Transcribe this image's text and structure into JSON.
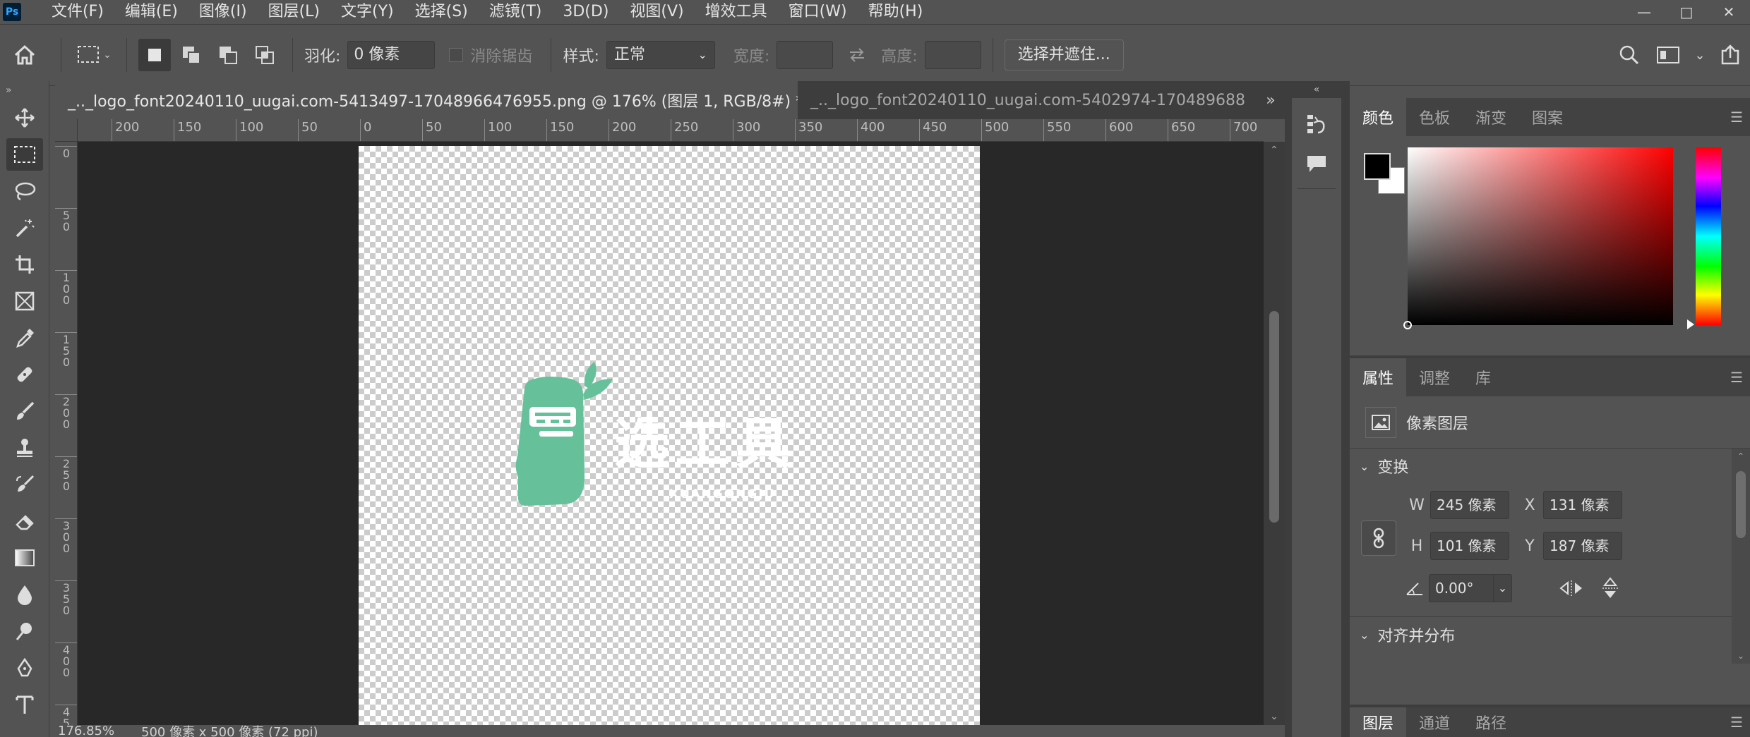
{
  "app": {
    "icon": "Ps"
  },
  "menu": [
    "文件(F)",
    "编辑(E)",
    "图像(I)",
    "图层(L)",
    "文字(Y)",
    "选择(S)",
    "滤镜(T)",
    "3D(D)",
    "视图(V)",
    "增效工具",
    "窗口(W)",
    "帮助(H)"
  ],
  "window_controls": {
    "minimize": "—",
    "restore": "□",
    "close": "✕"
  },
  "options": {
    "feather_label": "羽化:",
    "feather_value": "0 像素",
    "antialias_label": "消除锯齿",
    "style_label": "样式:",
    "style_value": "正常",
    "width_label": "宽度:",
    "height_label": "高度:",
    "select_mask_button": "选择并遮住..."
  },
  "document_tabs": [
    {
      "title": "_.._logo_font20240110_uugai.com-5413497-17048966476955.png @ 176% (图层 1, RGB/8#) *",
      "close": "✕",
      "active": true
    },
    {
      "title": "_.._logo_font20240110_uugai.com-5402974-170489688",
      "active": false
    }
  ],
  "rulers": {
    "horizontal": [
      "200",
      "150",
      "100",
      "50",
      "0",
      "50",
      "100",
      "150",
      "200",
      "250",
      "300",
      "350",
      "400",
      "450",
      "500",
      "550",
      "600",
      "650",
      "700"
    ],
    "vertical": [
      "0",
      "5\n0",
      "1\n0\n0",
      "1\n5\n0",
      "2\n0\n0",
      "2\n5\n0",
      "3\n0\n0",
      "3\n5\n0",
      "4\n0\n0",
      "4\n5"
    ]
  },
  "canvas": {
    "logo_text": "选工具",
    "logo_subtext": "XUANGONGJU",
    "logo_color": "#66c19b"
  },
  "status": {
    "zoom": "176.85%",
    "doc_size": "500 像素 x 500 像素 (72 ppi)"
  },
  "color_panel": {
    "tabs": [
      "颜色",
      "色板",
      "渐变",
      "图案"
    ],
    "foreground": "#000000",
    "background": "#ffffff"
  },
  "properties_panel": {
    "tabs": [
      "属性",
      "调整",
      "库"
    ],
    "layer_type": "像素图层",
    "transform_title": "变换",
    "w_label": "W",
    "w_value": "245 像素",
    "x_label": "X",
    "x_value": "131 像素",
    "h_label": "H",
    "h_value": "101 像素",
    "y_label": "Y",
    "y_value": "187 像素",
    "angle_value": "0.00°",
    "align_title": "对齐并分布"
  },
  "layers_panel": {
    "tabs": [
      "图层",
      "通道",
      "路径"
    ]
  },
  "colors": {
    "app_bg": "#535353",
    "workspace": "#282828",
    "accent_logo": "#66c19b"
  }
}
